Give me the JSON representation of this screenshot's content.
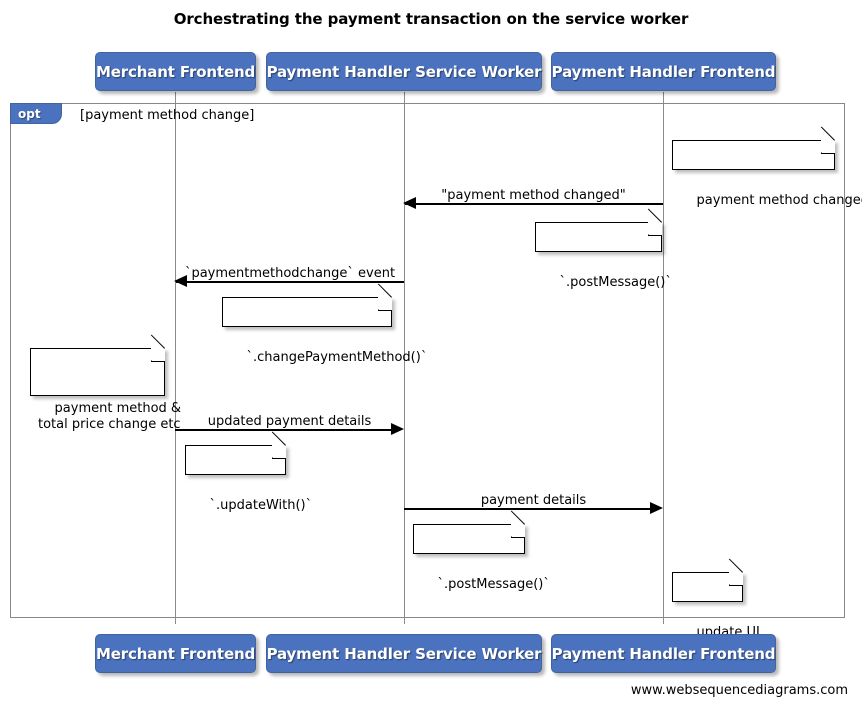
{
  "diagram": {
    "title": "Orchestrating the payment transaction on the service worker",
    "footer_url": "www.websequencediagrams.com",
    "colors": {
      "actor_fill": "#4B72BE",
      "actor_text": "#FFFFFF",
      "frame_border": "#888888",
      "line": "#000000",
      "note_fill": "#FFFFFF",
      "background": "#FFFFFF"
    }
  },
  "actors": [
    {
      "id": "merchant-frontend",
      "label": "Merchant Frontend"
    },
    {
      "id": "payment-handler-service-worker",
      "label": "Payment Handler Service Worker"
    },
    {
      "id": "payment-handler-frontend",
      "label": "Payment Handler Frontend"
    }
  ],
  "fragment": {
    "type": "opt",
    "guard": "[payment method change]"
  },
  "messages": [
    {
      "id": "payment-method-changed",
      "label": "\"payment method changed\"",
      "from": "payment-handler-frontend",
      "to": "payment-handler-service-worker",
      "direction": "left"
    },
    {
      "id": "paymentmethodchange-event",
      "label": "`paymentmethodchange` event",
      "from": "payment-handler-service-worker",
      "to": "merchant-frontend",
      "direction": "left"
    },
    {
      "id": "updated-payment-details",
      "label": "updated payment details",
      "from": "merchant-frontend",
      "to": "payment-handler-service-worker",
      "direction": "right"
    },
    {
      "id": "payment-details",
      "label": "payment details",
      "from": "payment-handler-service-worker",
      "to": "payment-handler-frontend",
      "direction": "right"
    }
  ],
  "notes": [
    {
      "id": "note-payment-method-changed",
      "text": "payment method changed",
      "over": "payment-handler-frontend"
    },
    {
      "id": "note-post-message-1",
      "text": "`.postMessage()`",
      "over": "payment-handler-frontend"
    },
    {
      "id": "note-change-payment-method",
      "text": "`.changePaymentMethod()`",
      "over": "payment-handler-service-worker"
    },
    {
      "id": "note-payment-method-total-price",
      "text": "payment method &\ntotal price change etc",
      "over": "merchant-frontend"
    },
    {
      "id": "note-update-with",
      "text": "`.updateWith()`",
      "over": "merchant-frontend"
    },
    {
      "id": "note-post-message-2",
      "text": "`.postMessage()`",
      "over": "payment-handler-service-worker"
    },
    {
      "id": "note-update-ui",
      "text": "update UI",
      "over": "payment-handler-frontend"
    }
  ]
}
